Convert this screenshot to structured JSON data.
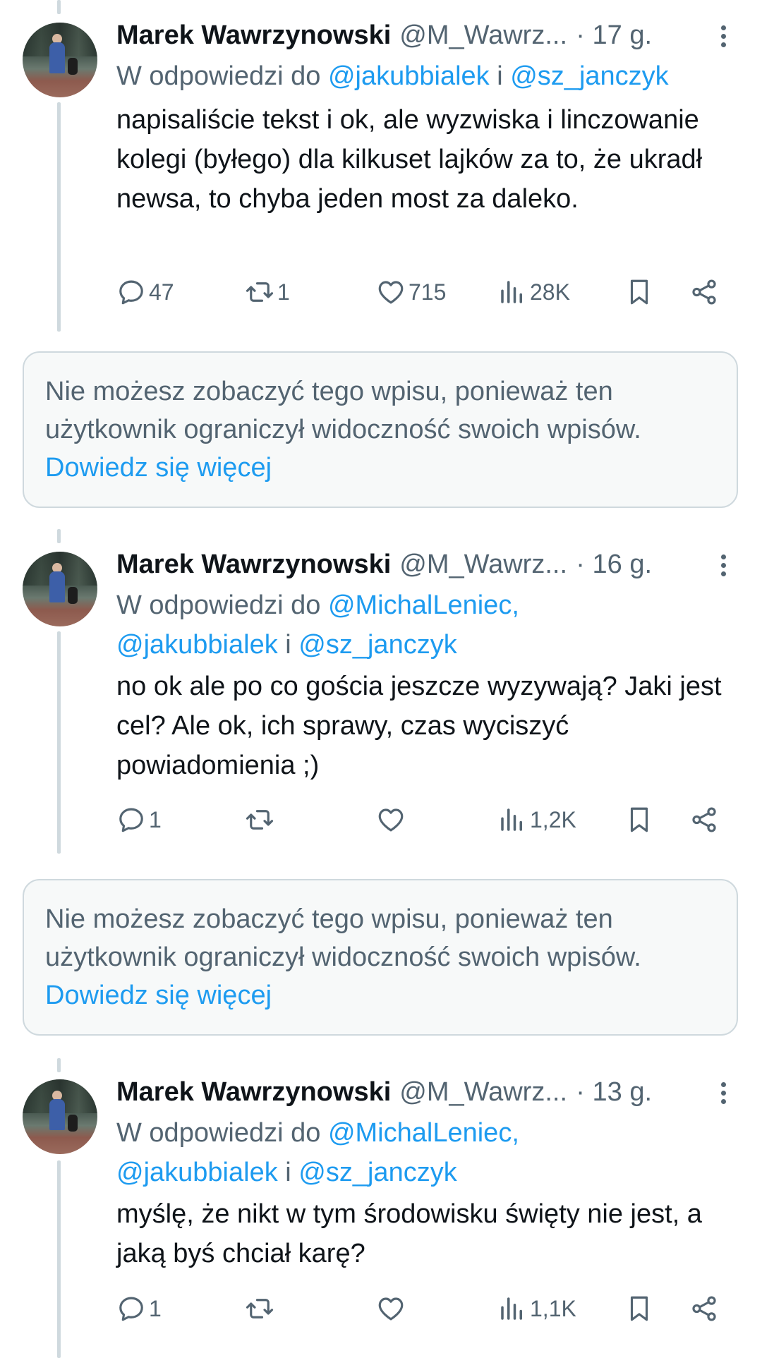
{
  "tweets": [
    {
      "name": "Marek Wawrzynowski",
      "handle": "@M_Wawrz...",
      "time": "· 17 g.",
      "reply_prefix": "W odpowiedzi do",
      "reply_line1": [
        {
          "text": "@jakubbialek",
          "mention": true
        },
        {
          "text": " i ",
          "mention": false
        },
        {
          "text": "@sz_janczyk",
          "mention": true
        }
      ],
      "reply_line2": [],
      "text": "napisaliście tekst i ok, ale wyzwiska i linczowanie kolegi (byłego) dla kilkuset lajków za to, że ukradł newsa, to chyba jeden most za daleko.",
      "stats": {
        "replies": "47",
        "reposts": "1",
        "likes": "715",
        "views": "28K"
      }
    },
    {
      "name": "Marek Wawrzynowski",
      "handle": "@M_Wawrz...",
      "time": "· 16 g.",
      "reply_prefix": "W odpowiedzi do",
      "reply_line1": [
        {
          "text": "@MichalLeniec,",
          "mention": true
        }
      ],
      "reply_line2": [
        {
          "text": "@jakubbialek",
          "mention": true
        },
        {
          "text": " i ",
          "mention": false
        },
        {
          "text": "@sz_janczyk",
          "mention": true
        }
      ],
      "text": "no ok ale po co gościa jeszcze wyzywają? Jaki jest cel? Ale ok, ich sprawy, czas wyciszyć powiadomienia ;)",
      "stats": {
        "replies": "1",
        "reposts": "",
        "likes": "",
        "views": "1,2K"
      }
    },
    {
      "name": "Marek Wawrzynowski",
      "handle": "@M_Wawrz...",
      "time": "· 13 g.",
      "reply_prefix": "W odpowiedzi do",
      "reply_line1": [
        {
          "text": "@MichalLeniec,",
          "mention": true
        }
      ],
      "reply_line2": [
        {
          "text": "@jakubbialek",
          "mention": true
        },
        {
          "text": " i ",
          "mention": false
        },
        {
          "text": "@sz_janczyk",
          "mention": true
        }
      ],
      "text": "myślę, że nikt w tym środowisku święty nie jest, a jaką byś chciał karę?",
      "stats": {
        "replies": "1",
        "reposts": "",
        "likes": "",
        "views": "1,1K"
      }
    }
  ],
  "notices": [
    {
      "text": "Nie możesz zobaczyć tego wpisu, ponieważ ten użytkownik ograniczył widoczność swoich wpisów.",
      "link": "Dowiedz się więcej"
    },
    {
      "text": "Nie możesz zobaczyć tego wpisu, ponieważ ten użytkownik ograniczył widoczność swoich wpisów.",
      "link": "Dowiedz się więcej"
    }
  ],
  "colors": {
    "accent": "#1d9bf0",
    "secondary_text": "#536471",
    "primary_text": "#0f1419"
  },
  "icons": {
    "reply": "reply-icon",
    "repost": "repost-icon",
    "like": "heart-icon",
    "views": "views-icon",
    "bookmark": "bookmark-icon",
    "share": "share-icon",
    "more": "more-icon"
  }
}
